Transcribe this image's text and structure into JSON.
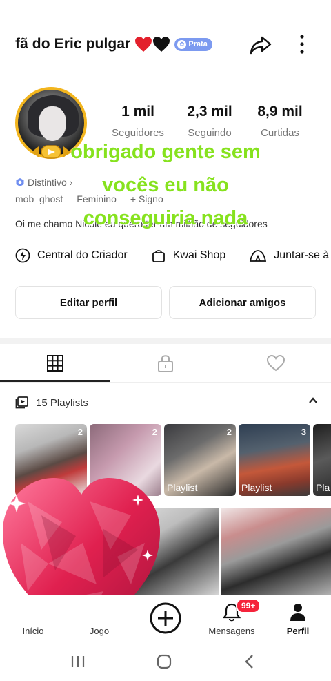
{
  "header": {
    "username": "fã do Eric pulgar",
    "hearts": [
      "red-heart",
      "black-heart"
    ],
    "badge": "Prata",
    "icons": [
      "share-icon",
      "more-vertical-icon"
    ]
  },
  "stats": [
    {
      "value": "1 mil",
      "label": "Seguidores"
    },
    {
      "value": "2,3 mil",
      "label": "Seguindo"
    },
    {
      "value": "8,9 mil",
      "label": "Curtidas"
    }
  ],
  "profile": {
    "distintivo": "Distintivo",
    "handle": "mob_ghost",
    "gender": "Feminino",
    "sign": "+ Signo",
    "bio": "Oi me chamo Nicole eu quero ter um milhão de seguidores"
  },
  "overlay": {
    "lines": [
      "obrigado gente sem",
      "vocês eu não",
      "conseguiria nada"
    ]
  },
  "tools": [
    {
      "label": "Central do Criador",
      "icon": "lightning-icon"
    },
    {
      "label": "Kwai Shop",
      "icon": "shopping-bag-icon"
    },
    {
      "label": "Juntar-se à",
      "icon": "tent-icon"
    }
  ],
  "buttons": {
    "edit": "Editar perfil",
    "add_friends": "Adicionar amigos"
  },
  "tabs": [
    {
      "icon": "grid-icon",
      "active": true
    },
    {
      "icon": "lock-icon",
      "active": false
    },
    {
      "icon": "heart-outline-icon",
      "active": false
    }
  ],
  "playlists": {
    "title": "15 Playlists",
    "items": [
      {
        "count": "2",
        "label": ""
      },
      {
        "count": "2",
        "label": ""
      },
      {
        "count": "2",
        "label": "Playlist"
      },
      {
        "count": "3",
        "label": "Playlist"
      },
      {
        "count": "",
        "label": "Pla"
      }
    ]
  },
  "bottom_nav": {
    "items": [
      {
        "label": "Início",
        "icon": "home-icon"
      },
      {
        "label": "Jogo",
        "icon": "game-icon"
      },
      {
        "label": "",
        "icon": "plus-circle-icon"
      },
      {
        "label": "Mensagens",
        "icon": "bell-icon"
      },
      {
        "label": "Perfil",
        "icon": "person-icon"
      }
    ],
    "messages_badge": "99+"
  },
  "system_nav": [
    "recents-icon",
    "home-circle-icon",
    "back-icon"
  ],
  "colors": {
    "overlay_green": "#86e21e",
    "badge_blue": "#7c9af0",
    "notification_red": "#f5233b",
    "avatar_gold": "#f2b51e"
  }
}
